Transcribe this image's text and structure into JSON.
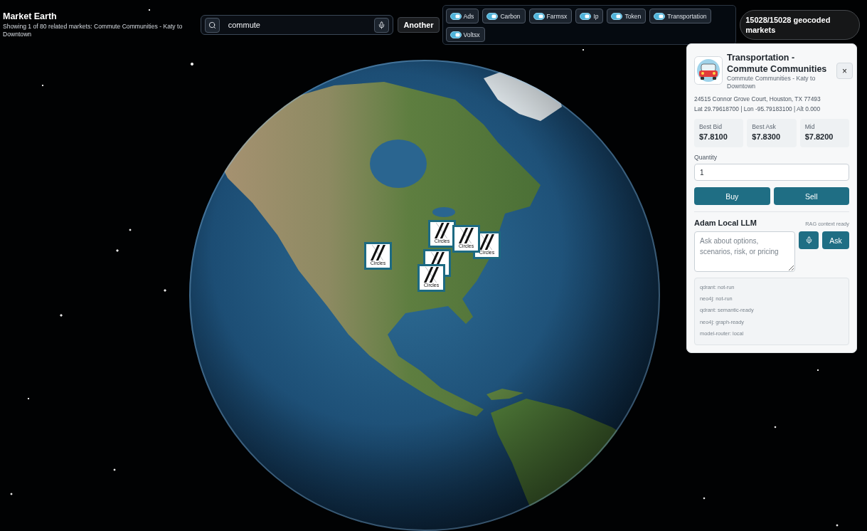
{
  "header": {
    "title": "Market Earth",
    "subtitle": "Showing 1 of 80 related markets: Commute Communities - Katy to Downtown"
  },
  "search": {
    "value": "commute"
  },
  "another_button": "Another",
  "filters": [
    {
      "label": "Ads",
      "on": true
    },
    {
      "label": "Carbon",
      "on": true
    },
    {
      "label": "Farmsx",
      "on": true
    },
    {
      "label": "Ip",
      "on": true
    },
    {
      "label": "Token",
      "on": true
    },
    {
      "label": "Transportation",
      "on": true
    },
    {
      "label": "Voltsx",
      "on": true
    }
  ],
  "geocoded_count": "15028/15028 geocoded markets",
  "map": {
    "markers": [
      {
        "kind": "labeled",
        "label": "Circles"
      },
      {
        "kind": "labeled",
        "label": "Circles"
      },
      {
        "kind": "labeled",
        "label": "Circles"
      },
      {
        "kind": "labeled",
        "label": "Circles"
      },
      {
        "kind": "covered"
      },
      {
        "kind": "labeled",
        "label": "Circles"
      }
    ]
  },
  "detail_panel": {
    "title": "Transportation - Commute Communities",
    "subtitle": "Commute Communities - Katy to Downtown",
    "close": "×",
    "address": "24515 Connor Grove Court, Houston, TX 77493",
    "coordinates": "Lat 29.79618700 | Lon -95.79183100 | Alt 0.000",
    "quotes": [
      {
        "label": "Best Bid",
        "value": "$7.8100"
      },
      {
        "label": "Best Ask",
        "value": "$7.8300"
      },
      {
        "label": "Mid",
        "value": "$7.8200"
      }
    ],
    "quantity": {
      "label": "Quantity",
      "value": "1"
    },
    "actions": [
      {
        "label": "Buy"
      },
      {
        "label": "Sell"
      }
    ],
    "assistant": {
      "title": "Adam Local LLM",
      "status": "RAG context ready",
      "placeholder": "Ask about options, scenarios, risk, or pricing",
      "ask_button": "Ask"
    },
    "services": [
      "qdrant: not-run",
      "neo4j: not-run",
      "qdrant: semantic-ready",
      "neo4j: graph-ready",
      "model-router: local"
    ]
  }
}
